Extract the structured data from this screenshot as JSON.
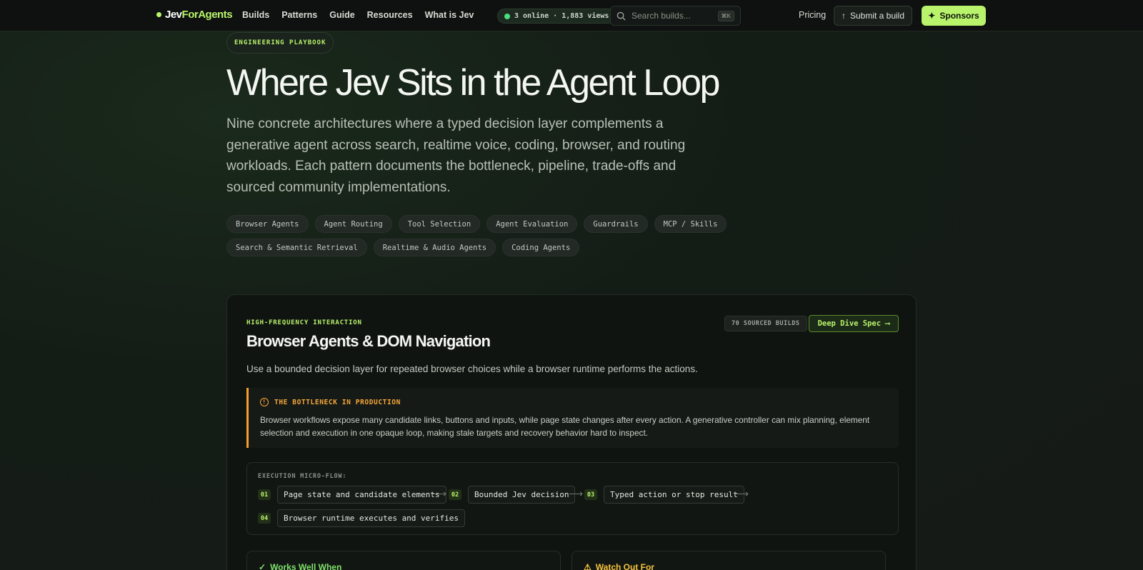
{
  "nav": {
    "logo_a": "Jev",
    "logo_b": "ForAgents",
    "links": [
      "Builds",
      "Patterns",
      "Guide",
      "Resources",
      "What is Jev"
    ],
    "online_text": "3 online · 1,883 views",
    "search_placeholder": "Search builds...",
    "search_shortcut": "⌘K",
    "pricing": "Pricing",
    "submit_label": "Submit a build",
    "sponsor_label": "Sponsors"
  },
  "hero": {
    "eyebrow": "ENGINEERING PLAYBOOK",
    "title": "Where Jev Sits in the Agent Loop",
    "subtitle": "Nine concrete architectures where a typed decision layer complements a generative agent across search, realtime voice, coding, browser, and routing workloads. Each pattern documents the bottleneck, pipeline, trade-offs and sourced community implementations.",
    "tags": [
      "Browser Agents",
      "Agent Routing",
      "Tool Selection",
      "Agent Evaluation",
      "Guardrails",
      "MCP / Skills",
      "Search & Semantic Retrieval",
      "Realtime & Audio Agents",
      "Coding Agents"
    ]
  },
  "card": {
    "eyebrow": "HIGH-FREQUENCY INTERACTION",
    "title": "Browser Agents & DOM Navigation",
    "description": "Use a bounded decision layer for repeated browser choices while a browser runtime performs the actions.",
    "sourced_badge": "70 SOURCED BUILDS",
    "deep_dive": "Deep Dive Spec",
    "bottleneck_title": "THE BOTTLENECK IN PRODUCTION",
    "bottleneck_text": "Browser workflows expose many candidate links, buttons and inputs, while page state changes after every action. A generative controller can mix planning, element selection and execution in one opaque loop, making stale targets and recovery behavior hard to inspect.",
    "flow_label": "EXECUTION MICRO-FLOW:",
    "steps": [
      {
        "num": "01",
        "label": "Page state and candidate elements"
      },
      {
        "num": "02",
        "label": "Bounded Jev decision"
      },
      {
        "num": "03",
        "label": "Typed action or stop result"
      },
      {
        "num": "04",
        "label": "Browser runtime executes and verifies"
      }
    ],
    "works_well": "Works Well When",
    "watch_out": "Watch Out For"
  },
  "colors": {
    "accent": "#b8f36b",
    "warning": "#f5a63a",
    "online": "#4ade80"
  }
}
